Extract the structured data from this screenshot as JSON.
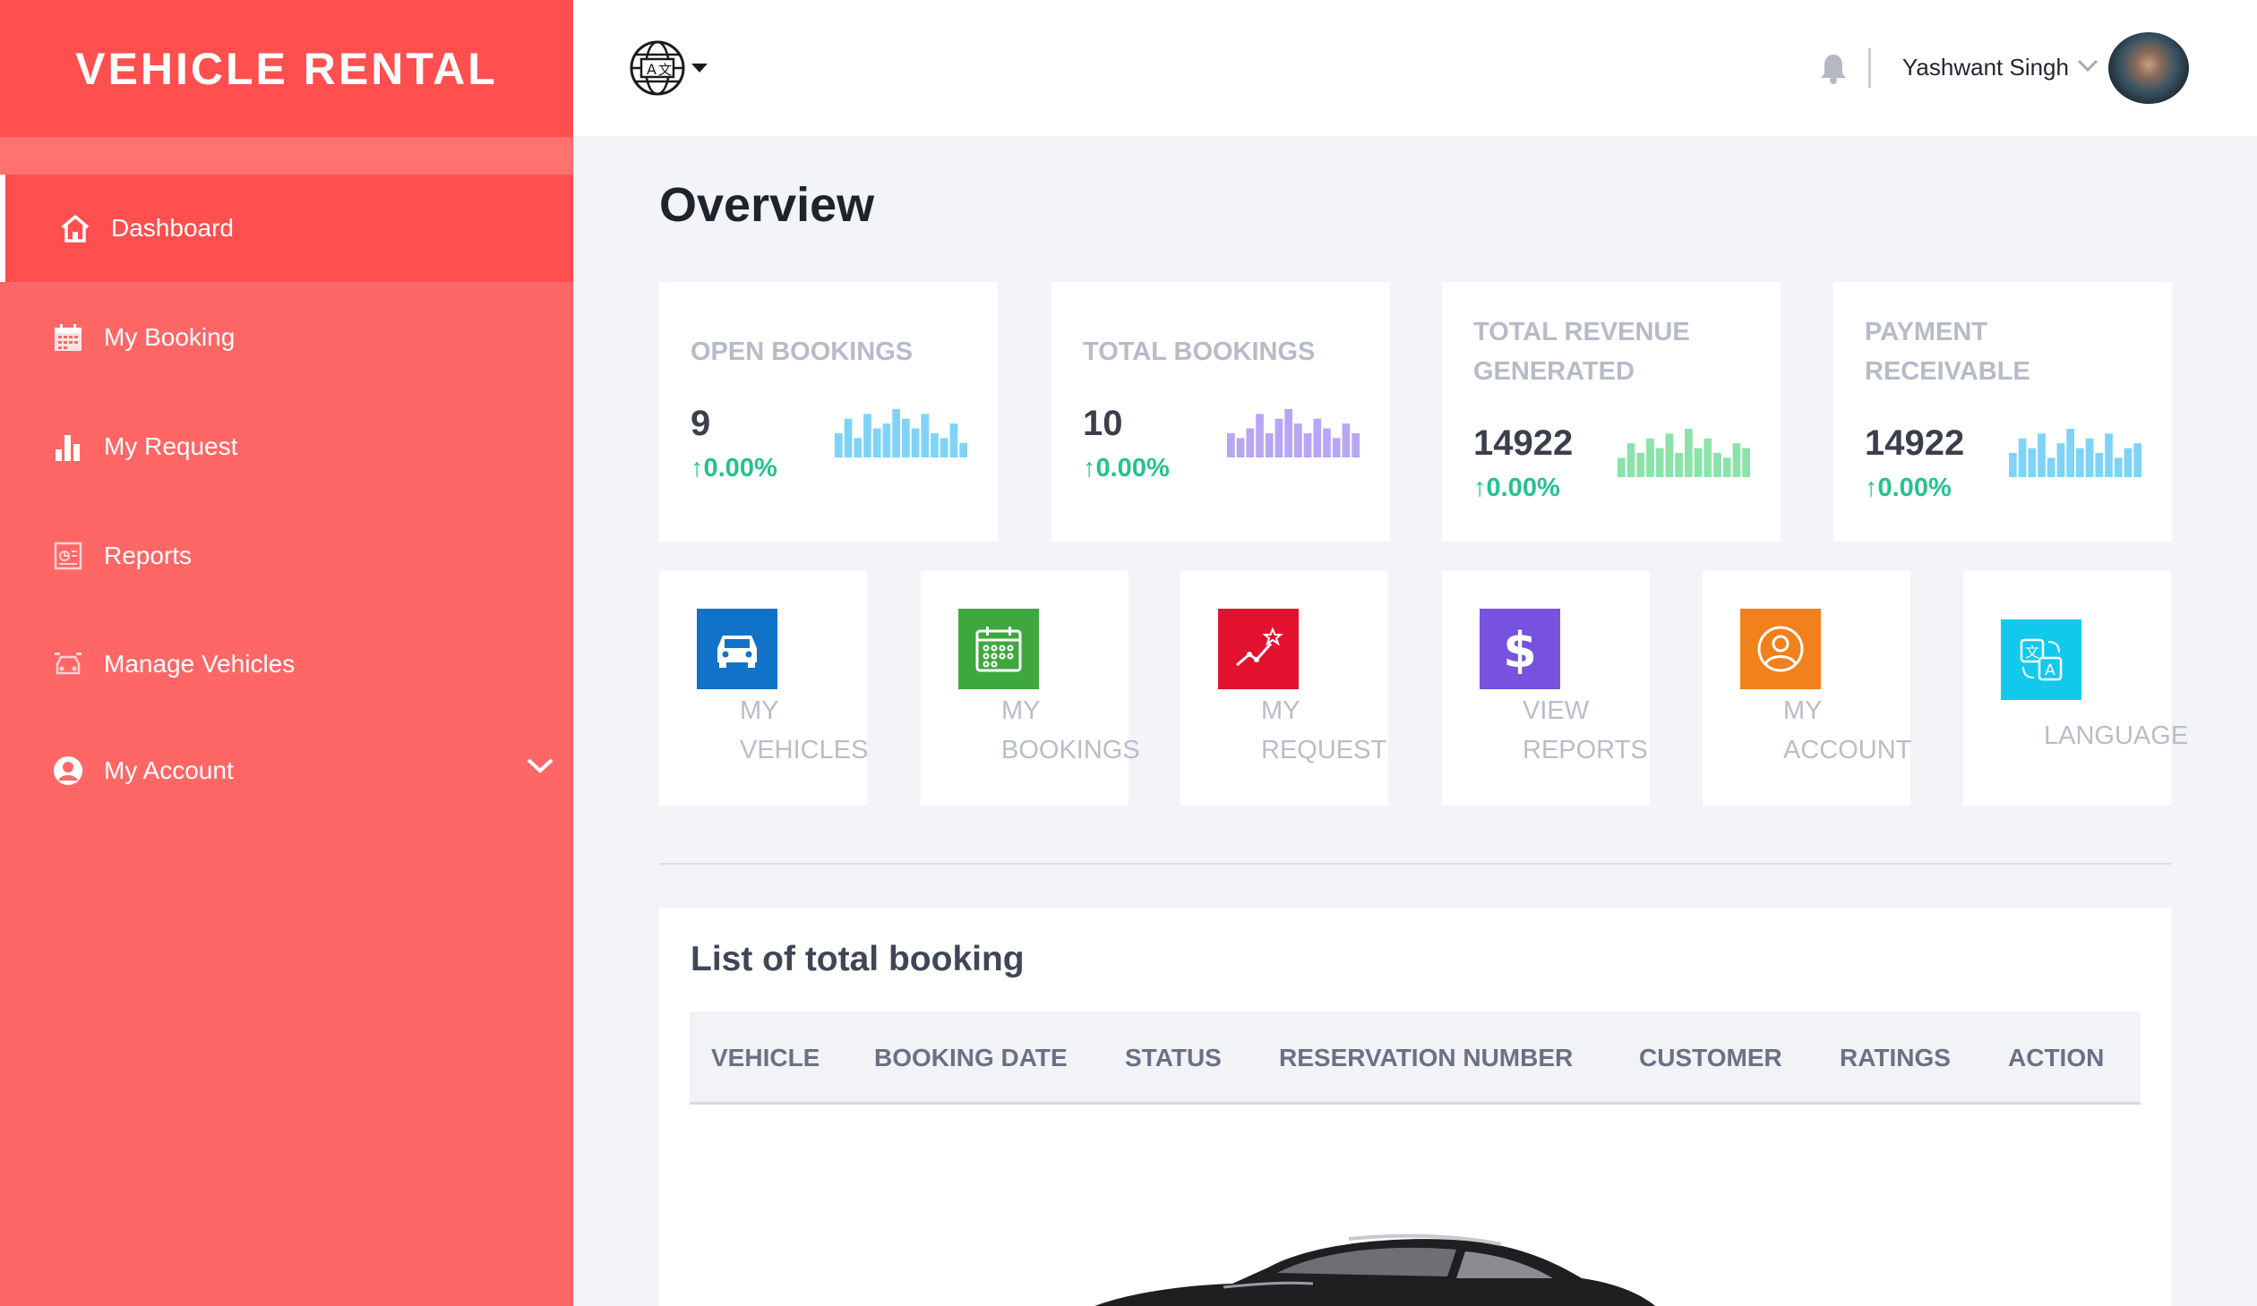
{
  "brand": {
    "name": "VEHICLE RENTAL"
  },
  "sidebar": {
    "items": [
      {
        "label": "Dashboard",
        "icon": "home-icon",
        "active": true
      },
      {
        "label": "My Booking",
        "icon": "calendar-icon"
      },
      {
        "label": "My Request",
        "icon": "bar-chart-icon"
      },
      {
        "label": "Reports",
        "icon": "report-icon"
      },
      {
        "label": "Manage Vehicles",
        "icon": "vehicle-icon"
      },
      {
        "label": "My Account",
        "icon": "user-circle-icon",
        "has_submenu": true
      }
    ]
  },
  "header": {
    "language_icon": "translate-globe-icon",
    "user_name": "Yashwant Singh"
  },
  "main": {
    "title": "Overview",
    "stats": [
      {
        "title": "OPEN BOOKINGS",
        "value": "9",
        "change": "0.00%",
        "spark_color": "#7fd3f7",
        "spark": [
          5,
          8,
          4,
          9,
          6,
          7,
          10,
          8,
          6,
          9,
          5,
          4,
          7,
          3
        ]
      },
      {
        "title": "TOTAL BOOKINGS",
        "value": "10",
        "change": "0.00%",
        "spark_color": "#b7a6f3",
        "spark": [
          5,
          4,
          6,
          9,
          5,
          8,
          10,
          7,
          5,
          8,
          6,
          4,
          7,
          5
        ]
      },
      {
        "title": "TOTAL REVENUE GENERATED",
        "value": "14922",
        "change": "0.00%",
        "spark_color": "#8be3a9",
        "spark": [
          4,
          7,
          5,
          8,
          6,
          9,
          5,
          10,
          6,
          8,
          5,
          4,
          7,
          6
        ]
      },
      {
        "title": "PAYMENT RECEIVABLE",
        "value": "14922",
        "change": "0.00%",
        "spark_color": "#7fd3f7",
        "spark": [
          5,
          8,
          6,
          9,
          4,
          7,
          10,
          6,
          8,
          5,
          9,
          4,
          6,
          7
        ]
      }
    ],
    "tiles": [
      {
        "label": "MY\nVEHICLES",
        "icon": "car-icon",
        "color": "#1173c7"
      },
      {
        "label": "MY\nBOOKINGS",
        "icon": "calendar-grid-icon",
        "color": "#3ea83f"
      },
      {
        "label": "MY\nREQUEST",
        "icon": "trend-up-icon",
        "color": "#e2122f"
      },
      {
        "label": "VIEW\nREPORTS",
        "icon": "dollar-icon",
        "color": "#7652de"
      },
      {
        "label": "MY\nACCOUNT",
        "icon": "account-icon",
        "color": "#f0811c"
      },
      {
        "label": "LANGUAGE",
        "icon": "translate-icon",
        "color": "#12c9ec"
      }
    ],
    "list": {
      "title": "List of total booking",
      "columns": [
        "VEHICLE",
        "BOOKING DATE",
        "STATUS",
        "RESERVATION NUMBER",
        "CUSTOMER",
        "RATINGS",
        "ACTION"
      ],
      "empty_state_icon": "car-illustration-icon"
    }
  }
}
